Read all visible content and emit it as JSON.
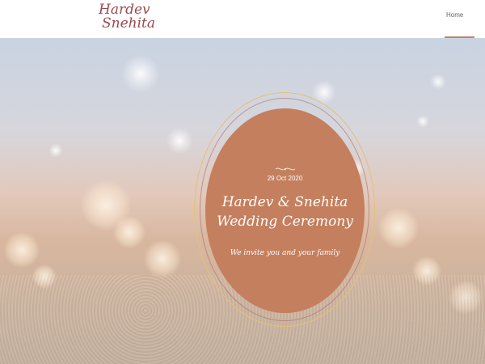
{
  "header": {
    "logo_line1": "Hardev",
    "logo_line2": "Snehita",
    "nav": {
      "home_label": "Home"
    }
  },
  "hero": {
    "date": "29 Oct 2020",
    "title_line1": "Hardev & Snehita",
    "title_line2": "Wedding Ceremony",
    "invite": "We invite you and your family"
  },
  "colors": {
    "oval": "#c47f5e",
    "logo": "#9a4a4e",
    "gold_ring": "#e3c07a",
    "nav_underline": "#c8845f"
  }
}
